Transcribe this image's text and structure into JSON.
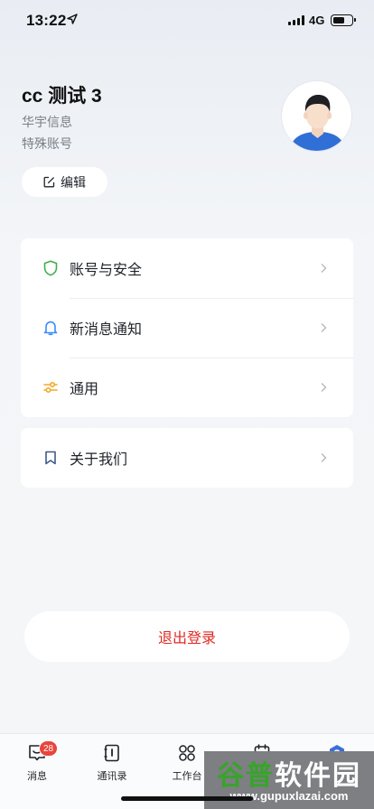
{
  "status_bar": {
    "time": "13:22",
    "network": "4G"
  },
  "profile": {
    "name": "cc 测试 3",
    "company": "华宇信息",
    "account_type": "特殊账号",
    "edit_label": "编辑"
  },
  "settings": {
    "items": [
      {
        "label": "账号与安全",
        "icon": "shield-icon",
        "color": "#3fae4a"
      },
      {
        "label": "新消息通知",
        "icon": "bell-icon",
        "color": "#3b8cff"
      },
      {
        "label": "通用",
        "icon": "sliders-icon",
        "color": "#f0a92a"
      }
    ],
    "about": {
      "label": "关于我们",
      "icon": "bookmark-icon",
      "color": "#3f5a8a"
    }
  },
  "logout_label": "退出登录",
  "tabs": [
    {
      "label": "消息",
      "icon": "message-icon",
      "badge": "28"
    },
    {
      "label": "通讯录",
      "icon": "contacts-icon"
    },
    {
      "label": "工作台",
      "icon": "apps-icon"
    }
  ],
  "watermark": {
    "title_part1": "谷普",
    "title_part2": "软件园",
    "url": "www.gupuxlazai.com"
  },
  "colors": {
    "danger": "#e02a23",
    "badge": "#e8453c",
    "background": "#f5f6f8"
  }
}
